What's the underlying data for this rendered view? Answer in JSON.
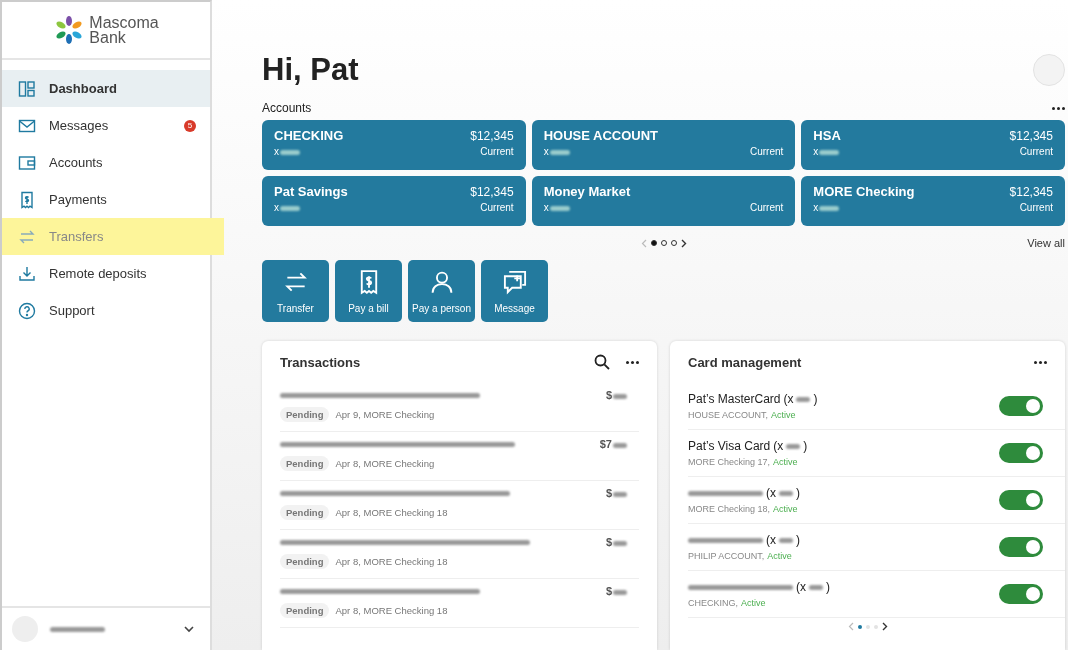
{
  "logo": {
    "line1": "Mascoma",
    "line2": "Bank"
  },
  "nav": [
    {
      "label": "Dashboard",
      "selected": true,
      "highlighted": false
    },
    {
      "label": "Messages",
      "selected": false,
      "highlighted": false,
      "badge": "5"
    },
    {
      "label": "Accounts",
      "selected": false,
      "highlighted": false
    },
    {
      "label": "Payments",
      "selected": false,
      "highlighted": false
    },
    {
      "label": "Transfers",
      "selected": false,
      "highlighted": true
    },
    {
      "label": "Remote deposits",
      "selected": false,
      "highlighted": false
    },
    {
      "label": "Support",
      "selected": false,
      "highlighted": false
    }
  ],
  "greeting": "Hi, Pat",
  "accounts": {
    "title": "Accounts",
    "view_all": "View all",
    "items": [
      {
        "name": "CHECKING",
        "number": "x",
        "balance": "$12,345",
        "status": "Current"
      },
      {
        "name": "HOUSE ACCOUNT",
        "number": "x",
        "status": "Current"
      },
      {
        "name": "HSA",
        "number": "x",
        "balance": "$12,345",
        "status": "Current"
      },
      {
        "name": "Pat Savings",
        "number": "x",
        "balance": "$12,345",
        "status": "Current"
      },
      {
        "name": "Money Market",
        "number": "x",
        "status": "Current"
      },
      {
        "name": "MORE Checking",
        "number": "x",
        "balance": "$12,345",
        "status": "Current"
      }
    ],
    "pages": [
      {
        "selected": true
      },
      {
        "selected": false
      },
      {
        "selected": false
      }
    ]
  },
  "actions": [
    {
      "label": "Transfer"
    },
    {
      "label": "Pay a bill"
    },
    {
      "label": "Pay a person"
    },
    {
      "label": "Message"
    }
  ],
  "transactions": {
    "title": "Transactions",
    "rows": [
      {
        "amount": "$",
        "status": "Pending",
        "detail": "Apr 9, MORE Checking"
      },
      {
        "amount": "$7",
        "status": "Pending",
        "detail": "Apr 8, MORE Checking"
      },
      {
        "amount": "$",
        "status": "Pending",
        "detail": "Apr 8, MORE Checking 18"
      },
      {
        "amount": "$",
        "status": "Pending",
        "detail": "Apr 8, MORE Checking 18"
      },
      {
        "amount": "$",
        "status": "Pending",
        "detail": "Apr 8, MORE Checking 18"
      }
    ]
  },
  "card_management": {
    "title": "Card management",
    "cards": [
      {
        "name": "Pat’s MasterCard",
        "number": "(x",
        "number_end": ")",
        "account": "HOUSE ACCOUNT,",
        "state": "Active",
        "on": true
      },
      {
        "name": "Pat’s Visa Card",
        "number": "(x",
        "number_end": ")",
        "account": "MORE Checking 17,",
        "state": "Active",
        "on": true
      },
      {
        "number": "(x",
        "number_end": ")",
        "account": "MORE Checking 18,",
        "state": "Active",
        "on": true
      },
      {
        "number": "(x",
        "number_end": ")",
        "account": "PHILIP ACCOUNT,",
        "state": "Active",
        "on": true
      },
      {
        "number": "(x",
        "number_end": ")",
        "account": "CHECKING,",
        "state": "Active",
        "on": true
      }
    ],
    "pages": [
      {
        "selected": true
      },
      {
        "selected": false
      },
      {
        "selected": false
      }
    ]
  }
}
